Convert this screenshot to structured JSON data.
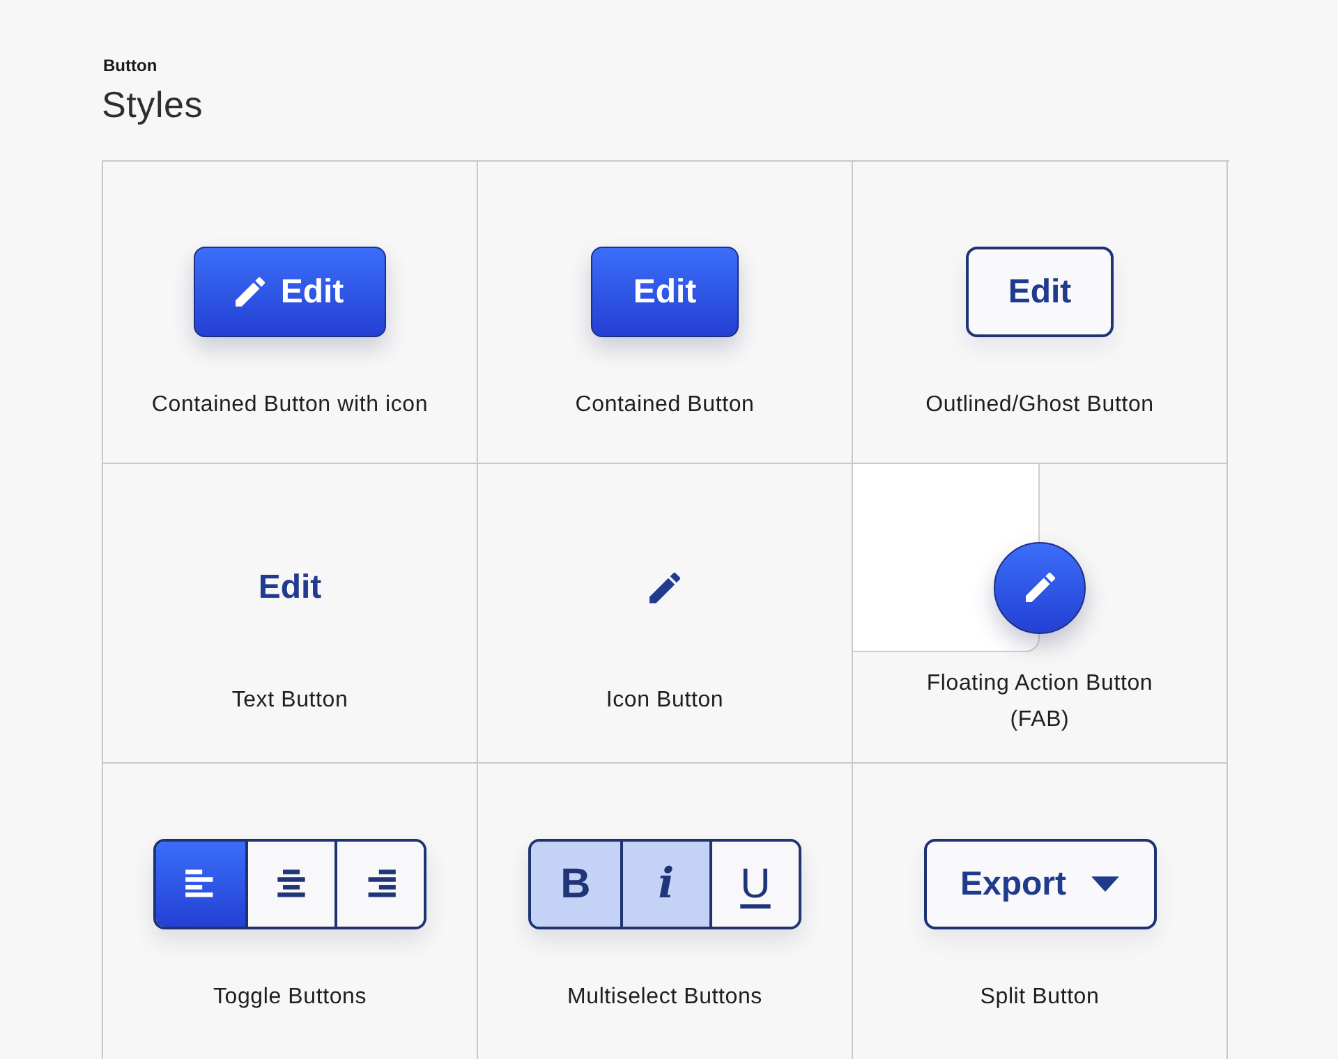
{
  "header": {
    "eyebrow": "Button",
    "title": "Styles"
  },
  "cells": [
    {
      "kind": "contained_icon",
      "button_label": "Edit",
      "caption": "Contained Button with icon"
    },
    {
      "kind": "contained",
      "button_label": "Edit",
      "caption": "Contained Button"
    },
    {
      "kind": "outlined",
      "button_label": "Edit",
      "caption": "Outlined/Ghost Button"
    },
    {
      "kind": "text",
      "button_label": "Edit",
      "caption": "Text Button"
    },
    {
      "kind": "icon",
      "caption": "Icon Button"
    },
    {
      "kind": "fab",
      "caption": "Floating Action Button (FAB)"
    },
    {
      "kind": "toggle",
      "caption": "Toggle Buttons",
      "options": [
        {
          "kind": "align_left",
          "selected": true
        },
        {
          "kind": "align_center",
          "selected": false
        },
        {
          "kind": "align_right",
          "selected": false
        }
      ]
    },
    {
      "kind": "multiselect",
      "caption": "Multiselect Buttons",
      "options": [
        {
          "kind": "bold",
          "label": "B",
          "selected": true
        },
        {
          "kind": "italic",
          "label": "i",
          "selected": true
        },
        {
          "kind": "underline",
          "label": "U",
          "selected": false
        }
      ]
    },
    {
      "kind": "split",
      "button_label": "Export",
      "caption": "Split Button"
    }
  ]
}
